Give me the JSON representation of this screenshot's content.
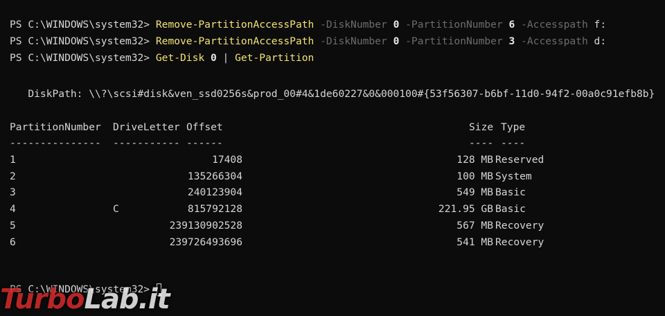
{
  "console": {
    "commands": [
      {
        "prompt": "PS C:\\WINDOWS\\system32> ",
        "cmd": "Remove-PartitionAccessPath",
        "p1": " -DiskNumber ",
        "v1": "0",
        "p2": " -PartitionNumber ",
        "v2": "6",
        "p3": " -Accesspath ",
        "v3": "f:"
      },
      {
        "prompt": "PS C:\\WINDOWS\\system32> ",
        "cmd": "Remove-PartitionAccessPath",
        "p1": " -DiskNumber ",
        "v1": "0",
        "p2": " -PartitionNumber ",
        "v2": "3",
        "p3": " -Accesspath ",
        "v3": "d:"
      }
    ],
    "pipe_command": {
      "prompt": "PS C:\\WINDOWS\\system32> ",
      "cmd1": "Get-Disk",
      "arg": " 0 ",
      "pipe": "| ",
      "cmd2": "Get-Partition"
    },
    "disk_path": "   DiskPath: \\\\?\\scsi#disk&ven_ssd0256s&prod_00#4&1de60227&0&000100#{53f56307-b6bf-11d0-94f2-00a0c91efb8b}",
    "table": {
      "headers": {
        "partition_number": "PartitionNumber",
        "drive_letter": "DriveLetter",
        "offset": "Offset",
        "size": "Size",
        "type": "Type"
      },
      "dashes": {
        "partition_number": "---------------",
        "drive_letter": "-----------",
        "offset": "------",
        "size": "----",
        "type": "----"
      },
      "rows": [
        {
          "num": "1",
          "letter": "",
          "offset": "17408",
          "size": "128 MB",
          "type": "Reserved"
        },
        {
          "num": "2",
          "letter": "",
          "offset": "135266304",
          "size": "100 MB",
          "type": "System"
        },
        {
          "num": "3",
          "letter": "",
          "offset": "240123904",
          "size": "549 MB",
          "type": "Basic"
        },
        {
          "num": "4",
          "letter": "C",
          "offset": "815792128",
          "size": "221.95 GB",
          "type": "Basic"
        },
        {
          "num": "5",
          "letter": "",
          "offset": "239130902528",
          "size": "567 MB",
          "type": "Recovery"
        },
        {
          "num": "6",
          "letter": "",
          "offset": "239726493696",
          "size": "541 MB",
          "type": "Recovery"
        }
      ]
    },
    "final_prompt": "PS C:\\WINDOWS\\system32> "
  },
  "watermark": {
    "part1": "Turbo",
    "part2": "Lab.it"
  }
}
